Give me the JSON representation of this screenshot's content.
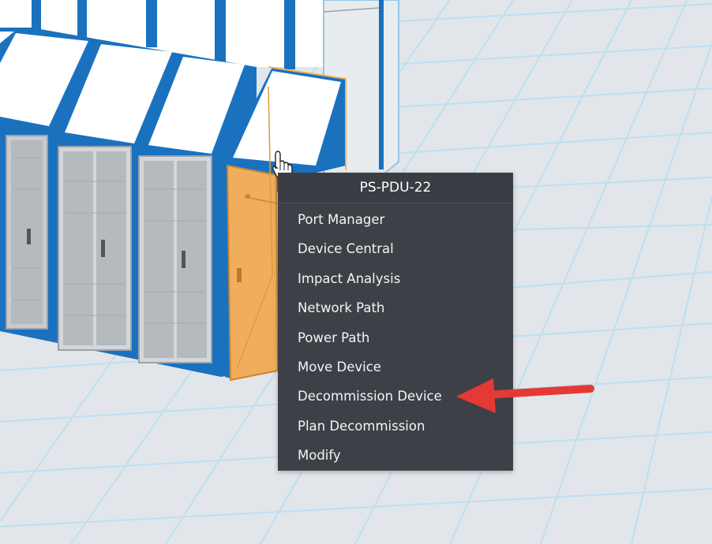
{
  "context_menu": {
    "title": "PS-PDU-22",
    "items": [
      {
        "label": "Port Manager"
      },
      {
        "label": "Device Central"
      },
      {
        "label": "Impact Analysis"
      },
      {
        "label": "Network Path"
      },
      {
        "label": "Power Path"
      },
      {
        "label": "Move Device"
      },
      {
        "label": "Decommission Device"
      },
      {
        "label": "Plan Decommission"
      },
      {
        "label": "Modify"
      }
    ]
  },
  "scene": {
    "floor_color": "#e2e6ea",
    "grid_color": "#bfe0f1",
    "rack_blue": "#1a72bf",
    "selected_rack_color": "#f0ad5c",
    "annotation_arrow_color": "#e53935"
  },
  "icons": {
    "cursor": "hand-pointer-icon",
    "annotation": "red-arrow-icon"
  }
}
